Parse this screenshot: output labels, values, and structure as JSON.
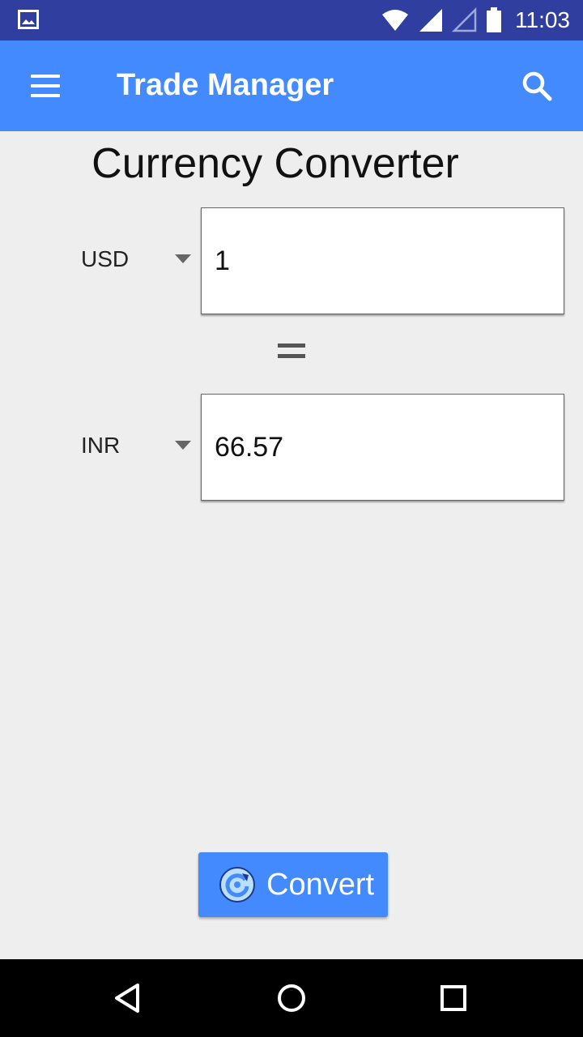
{
  "status_bar": {
    "time": "11:03",
    "icons": [
      "image-icon",
      "wifi-icon",
      "signal-icon",
      "signal-empty-icon",
      "battery-icon"
    ]
  },
  "app_bar": {
    "title": "Trade Manager",
    "icons": [
      "menu-icon",
      "search-icon"
    ],
    "color": "#448aff"
  },
  "converter": {
    "title": "Currency Converter",
    "from_currency": "USD",
    "from_amount": "1",
    "equals": "=",
    "to_currency": "INR",
    "to_amount": "66.57",
    "convert_label": "Convert",
    "convert_icon": "refresh-icon"
  },
  "nav_bar": {
    "icons": [
      "back-icon",
      "home-icon",
      "recents-icon"
    ]
  },
  "colors": {
    "status_bar": "#303f9f",
    "accent": "#448aff",
    "background": "#eeeeee"
  }
}
